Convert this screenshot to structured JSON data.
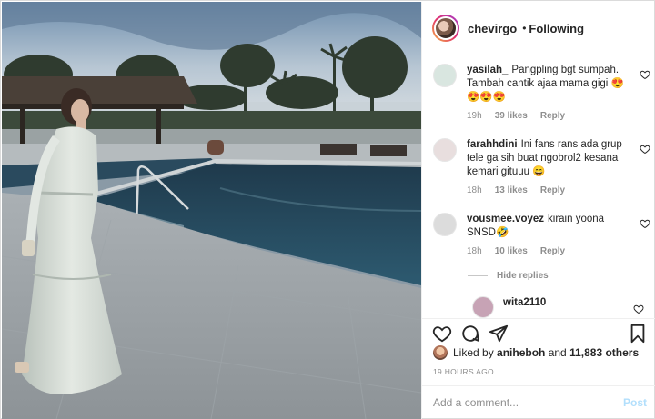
{
  "header": {
    "username": "chevirgo",
    "separator": "•",
    "follow_status": "Following"
  },
  "comments": [
    {
      "username": "yasilah_",
      "text": "Pangpling bgt sumpah. Tambah cantik ajaa mama gigi 😍😍😍😍",
      "time": "19h",
      "likes": "39 likes",
      "reply": "Reply",
      "avatar_color": "#d9e6e0"
    },
    {
      "username": "farahhdini",
      "text": "Ini fans rans ada grup tele ga sih buat ngobrol2 kesana kemari gituuu 😄",
      "time": "18h",
      "likes": "13 likes",
      "reply": "Reply",
      "avatar_color": "#e8dede"
    },
    {
      "username": "vousmee.voyez",
      "text": "kirain yoona SNSD🤣",
      "time": "18h",
      "likes": "10 likes",
      "reply": "Reply",
      "avatar_color": "#dcdcdc"
    }
  ],
  "hide_replies": "Hide replies",
  "reply_preview": {
    "username": "wita2110",
    "avatar_color": "#c7a3b5"
  },
  "icons": {
    "like": "heart-icon",
    "comment": "comment-icon",
    "share": "share-icon",
    "save": "bookmark-icon"
  },
  "likes_summary": {
    "prefix": "Liked by ",
    "user": "aniheboh",
    "middle": " and ",
    "others": "11,883 others"
  },
  "timestamp": "19 HOURS AGO",
  "add_comment": {
    "placeholder": "Add a comment...",
    "post_label": "Post"
  },
  "colors": {
    "post_button": "#b2dffc",
    "meta_text": "#8e8e8e",
    "text": "#262626"
  }
}
